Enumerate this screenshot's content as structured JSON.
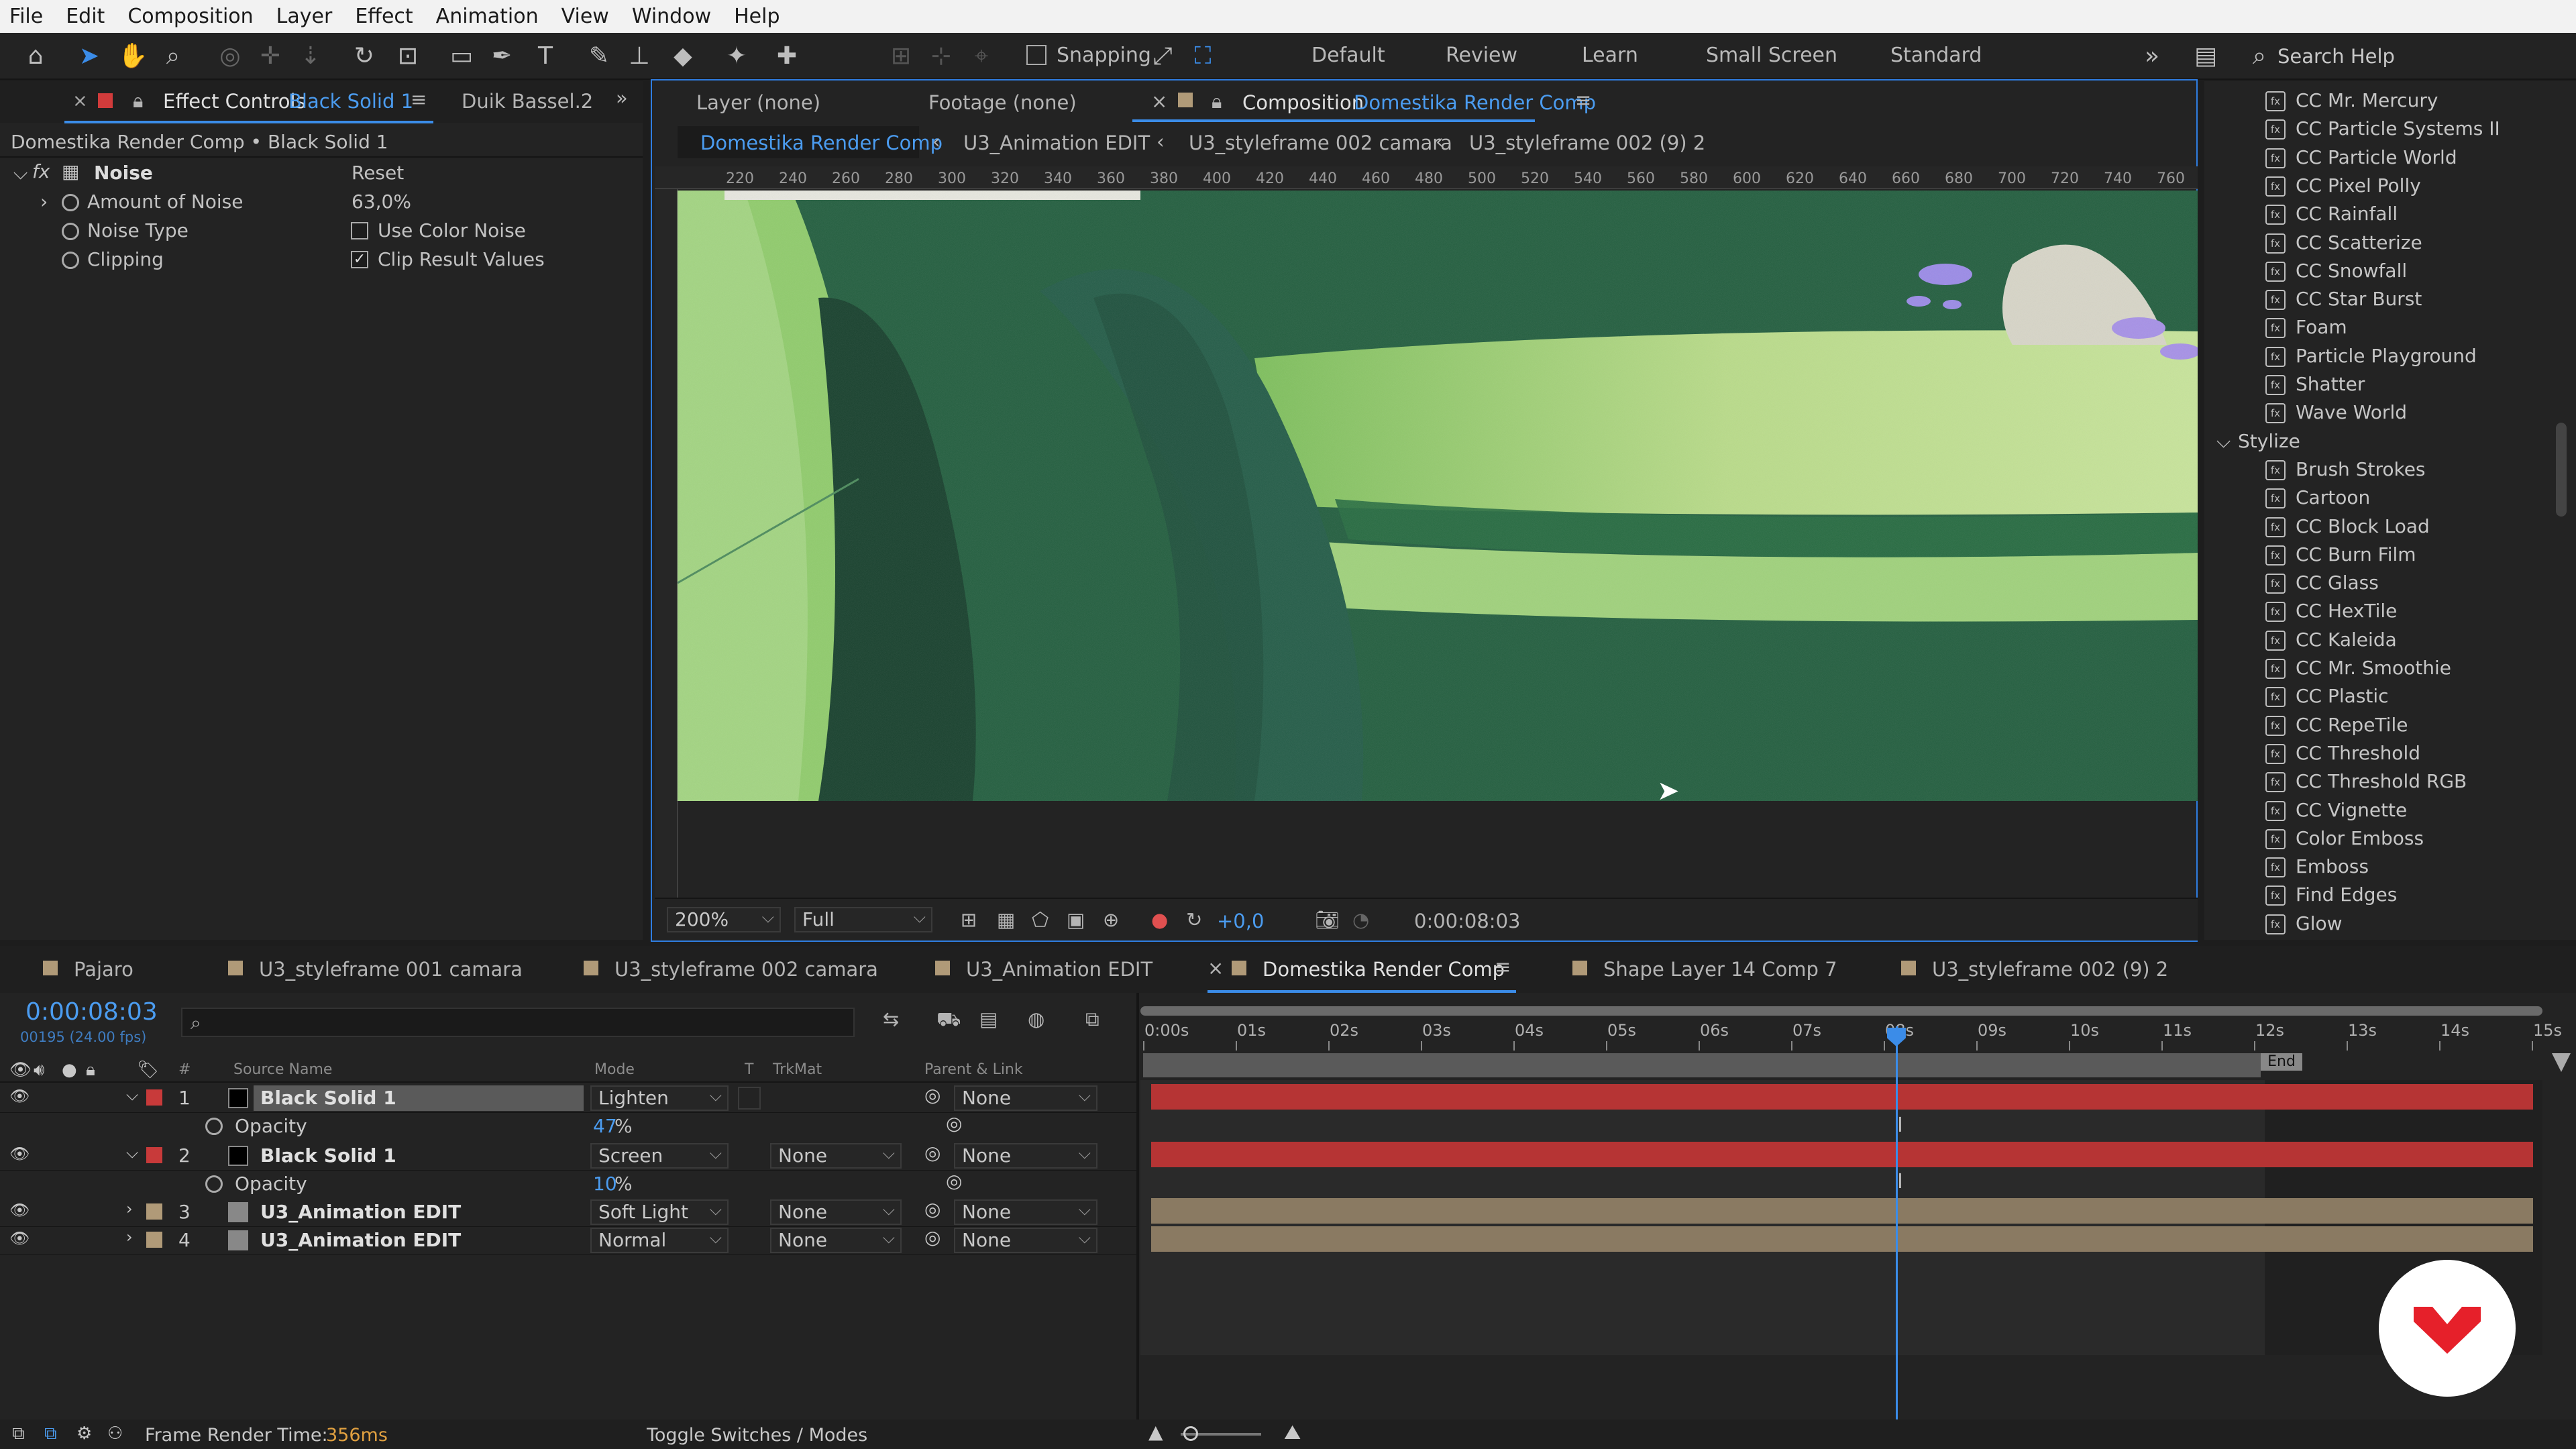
{
  "menu": [
    "File",
    "Edit",
    "Composition",
    "Layer",
    "Effect",
    "Animation",
    "View",
    "Window",
    "Help"
  ],
  "toolbar": {
    "snapping_label": "Snapping",
    "workspaces": [
      "Default",
      "Review",
      "Learn",
      "Small Screen",
      "Standard"
    ],
    "search_placeholder": "Search Help"
  },
  "effect_controls": {
    "tab_label": "Effect Controls",
    "tab_layer": "Black Solid 1",
    "tab2": "Duik Bassel.2",
    "path": "Domestika Render Comp • Black Solid 1",
    "effect_name": "Noise",
    "reset": "Reset",
    "props": [
      {
        "label": "Amount of Noise",
        "value": "63,0%"
      },
      {
        "label": "Noise Type",
        "value": "Use Color Noise",
        "checked": false
      },
      {
        "label": "Clipping",
        "value": "Clip Result Values",
        "checked": true
      }
    ]
  },
  "viewer": {
    "layer_tab": "Layer  (none)",
    "footage_tab": "Footage  (none)",
    "comp_tab_prefix": "Composition",
    "comp_tab_name": "Domestika Render Comp",
    "breadcrumbs": [
      "Domestika Render Comp",
      "U3_Animation EDIT",
      "U3_styleframe 002 camara",
      "U3_styleframe 002 (9) 2"
    ],
    "ruler": [
      "220",
      "240",
      "260",
      "280",
      "300",
      "320",
      "340",
      "360",
      "380",
      "400",
      "420",
      "440",
      "460",
      "480",
      "500",
      "520",
      "540",
      "560",
      "580",
      "600",
      "620",
      "640",
      "660",
      "680",
      "700",
      "720",
      "740",
      "760"
    ],
    "zoom": "200%",
    "resolution": "Full",
    "exposure": "+0,0",
    "timecode": "0:00:08:03"
  },
  "effects_list": {
    "items_top": [
      "CC Mr. Mercury",
      "CC Particle Systems II",
      "CC Particle World",
      "CC Pixel Polly",
      "CC Rainfall",
      "CC Scatterize",
      "CC Snowfall",
      "CC Star Burst",
      "Foam",
      "Particle Playground",
      "Shatter",
      "Wave World"
    ],
    "category": "Stylize",
    "items_stylize": [
      "Brush Strokes",
      "Cartoon",
      "CC Block Load",
      "CC Burn Film",
      "CC Glass",
      "CC HexTile",
      "CC Kaleida",
      "CC Mr. Smoothie",
      "CC Plastic",
      "CC RepeTile",
      "CC Threshold",
      "CC Threshold RGB",
      "CC Vignette",
      "Color Emboss",
      "Emboss",
      "Find Edges",
      "Glow"
    ]
  },
  "timeline": {
    "tabs": [
      {
        "label": "Pajaro",
        "color": "#b09a78"
      },
      {
        "label": "U3_styleframe 001 camara",
        "color": "#b09a78"
      },
      {
        "label": "U3_styleframe 002 camara",
        "color": "#b09a78"
      },
      {
        "label": "U3_Animation EDIT",
        "color": "#b09a78"
      },
      {
        "label": "Domestika Render Comp",
        "color": "#b09a78"
      },
      {
        "label": "Shape Layer 14 Comp 7",
        "color": "#b09a78"
      },
      {
        "label": "U3_styleframe 002 (9) 2",
        "color": "#b09a78"
      }
    ],
    "timecode": "0:00:08:03",
    "frame_info": "00195 (24.00 fps)",
    "columns": {
      "num": "#",
      "source": "Source Name",
      "mode": "Mode",
      "t": "T",
      "trkmat": "TrkMat",
      "parent": "Parent & Link"
    },
    "layers": [
      {
        "num": "1",
        "name": "Black Solid 1",
        "mode": "Lighten",
        "trkmat": "",
        "parent": "None",
        "color": "#c83a3a",
        "prop": "Opacity",
        "prop_value": "47",
        "unit": "%"
      },
      {
        "num": "2",
        "name": "Black Solid 1",
        "mode": "Screen",
        "trkmat": "None",
        "parent": "None",
        "color": "#c83a3a",
        "prop": "Opacity",
        "prop_value": "10",
        "unit": "%"
      },
      {
        "num": "3",
        "name": "U3_Animation EDIT",
        "mode": "Soft Light",
        "trkmat": "None",
        "parent": "None",
        "color": "#b09a78"
      },
      {
        "num": "4",
        "name": "U3_Animation EDIT",
        "mode": "Normal",
        "trkmat": "None",
        "parent": "None",
        "color": "#b09a78"
      }
    ],
    "time_ruler": [
      "0:00s",
      "01s",
      "02s",
      "03s",
      "04s",
      "05s",
      "06s",
      "07s",
      "08s",
      "09s",
      "10s",
      "11s",
      "12s",
      "13s",
      "14s",
      "15s"
    ],
    "end_label": "End",
    "playhead_seconds": 8.13,
    "render_time_label": "Frame Render Time:",
    "render_time_value": "356ms",
    "toggle_label": "Toggle Switches / Modes"
  },
  "colors": {
    "accent": "#3b8ce8",
    "layer_red": "#c83a3a",
    "layer_tan": "#8a7a62",
    "domestika": "#e6202a"
  }
}
